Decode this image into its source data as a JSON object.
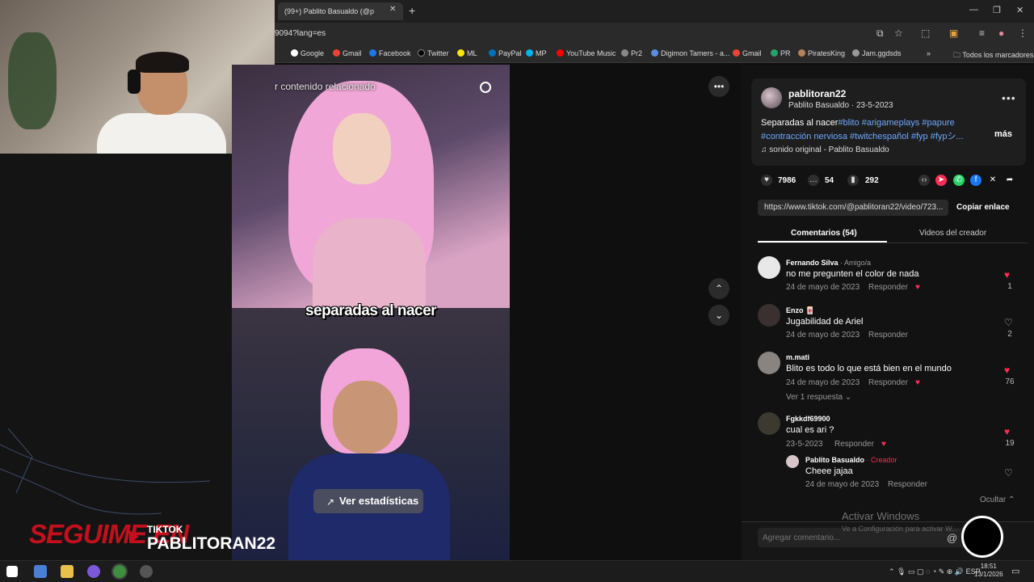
{
  "browser": {
    "tab_title": "(99+) Pablito Basualdo (@p",
    "url": "9094?lang=es",
    "bookmarks": [
      "Google",
      "Gmail",
      "Facebook",
      "Twitter",
      "ML",
      "PayPal",
      "MP",
      "YouTube Music",
      "Pr2",
      "Digimon Tamers - a...",
      "Gmail",
      "PR",
      "PiratesKing",
      "Jam.ggdsds"
    ],
    "bookmarks_more": "»",
    "all_bookmarks": "Todos los marcadores"
  },
  "video": {
    "search_text": "r contenido relacionado",
    "caption": "separadas al nacer",
    "stats_button": "Ver estadísticas"
  },
  "post": {
    "username": "pablitoran22",
    "subline": "Pablito Basualdo · 23-5-2023",
    "desc_plain": "Separadas al nacer",
    "desc_tags_1": "#blito #arigameplays #papure",
    "desc_line2": "#contracción nerviosa #twitchespañol #fyp #fypシ...",
    "more": "más",
    "sound": "sonido original - Pablito Basualdo",
    "likes": "7986",
    "comments": "54",
    "saves": "292",
    "link": "https://www.tiktok.com/@pablitoran22/video/723...",
    "copy_link": "Copiar enlace",
    "tab_comments": "Comentarios (54)",
    "tab_videos": "Videos del creador"
  },
  "comments": [
    {
      "name": "Fernando Silva",
      "sub": " · Amigo/a",
      "text": "no me pregunten el color de nada",
      "date": "24 de mayo de 2023",
      "reply": "Responder",
      "likes": "1",
      "liked": true,
      "avatar": "#e8e8e8"
    },
    {
      "name": "Enzo 🀄",
      "sub": "",
      "text": "Jugabilidad de Ariel",
      "date": "24 de mayo de 2023",
      "reply": "Responder",
      "likes": "2",
      "liked": false,
      "avatar": "#3a3030"
    },
    {
      "name": "m.mati",
      "sub": "",
      "text": "Blito es todo lo que está bien en el mundo",
      "date": "24 de mayo de 2023",
      "reply": "Responder",
      "likes": "76",
      "liked": true,
      "avatar": "#8a8480"
    },
    {
      "name": "Fgkkdf69900",
      "sub": "",
      "text": "cual es ari ?",
      "date": "23-5-2023",
      "reply": "Responder",
      "likes": "19",
      "liked": true,
      "avatar": "#3c3a30"
    }
  ],
  "replies_toggle": "Ver 1 respuesta",
  "reply": {
    "name": "Pablito Basualdo",
    "badge": " · Creador",
    "text": "Cheee jajaa",
    "date": "24 de mayo de 2023",
    "reply": "Responder"
  },
  "hide": "Ocultar",
  "comment_placeholder": "Agregar comentario...",
  "windows_watermark": {
    "line1": "Activar Windows",
    "line2": "Ve a Configuración para activar W..."
  },
  "overlay": {
    "seguime": "SEGUIME EN",
    "platform": "TIKTOK",
    "handle": "PABLITORAN22"
  },
  "taskbar": {
    "lang": "ESP",
    "time": "18:51",
    "date": "13/1/2026"
  },
  "colors": {
    "like_red": "#fe2c55",
    "hashtag_blue": "#6ea8ff",
    "creator_red": "#fe2c55",
    "brand_red": "#c3101c"
  }
}
